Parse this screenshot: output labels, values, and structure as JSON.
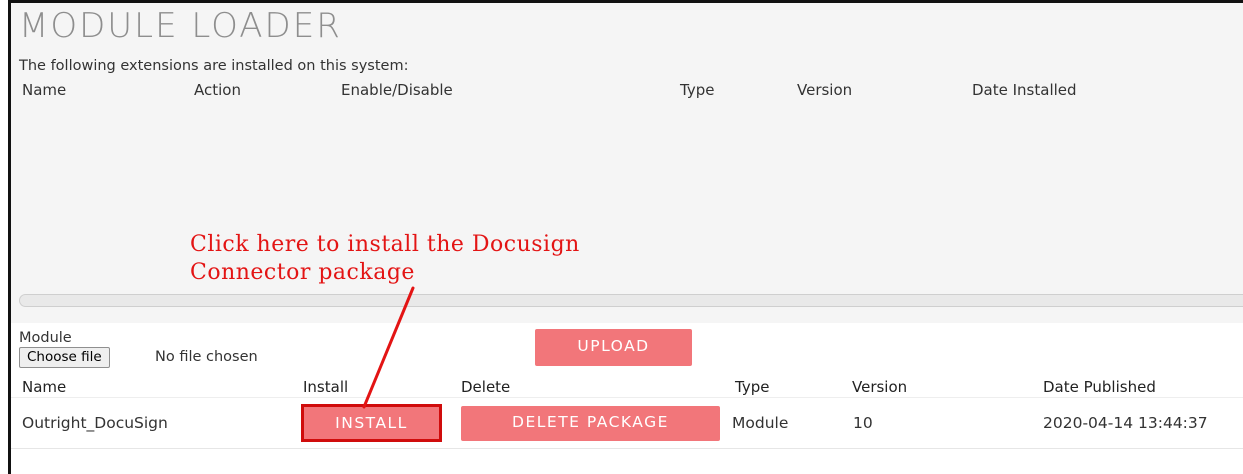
{
  "page": {
    "title": "MODULE LOADER",
    "intro_text": "The following extensions are installed on this system:"
  },
  "installed_table": {
    "headers": [
      "Name",
      "Action",
      "Enable/Disable",
      "Type",
      "Version",
      "Date Installed"
    ]
  },
  "annotation": {
    "line1": "Click here to install the Docusign",
    "line2": "Connector package",
    "color": "#e31414"
  },
  "upload": {
    "module_label": "Module",
    "choose_file_label": "Choose file",
    "file_status": "No file chosen",
    "upload_label": "UPLOAD"
  },
  "package_table": {
    "headers": [
      "Name",
      "Install",
      "Delete",
      "Type",
      "Version",
      "Date Published"
    ],
    "rows": [
      {
        "name": "Outright_DocuSign",
        "install_label": "INSTALL",
        "delete_label": "DELETE PACKAGE",
        "type": "Module",
        "version": "10",
        "date_published": "2020-04-14 13:44:37"
      }
    ]
  },
  "colors": {
    "button": "#f2767a",
    "highlight_border": "#d00c0c",
    "upper_panel": "#f5f5f5",
    "title": "#8e8e8e"
  }
}
